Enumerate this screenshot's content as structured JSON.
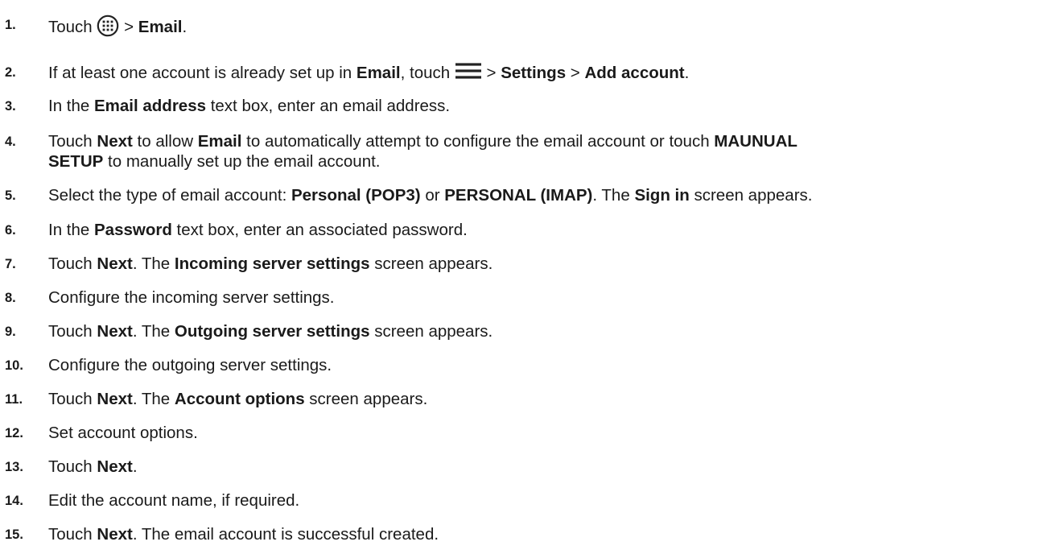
{
  "icons": {
    "apps": "apps-grid-icon",
    "menu": "hamburger-menu-icon"
  },
  "steps": [
    {
      "num": "1.",
      "parts": [
        {
          "t": "Touch "
        },
        {
          "icon": "apps"
        },
        {
          "t": " > "
        },
        {
          "t": "Email",
          "b": 1
        },
        {
          "t": "."
        }
      ]
    },
    {
      "num": "2.",
      "parts": [
        {
          "t": "If at least one account is already set up in "
        },
        {
          "t": "Email",
          "b": 1
        },
        {
          "t": ", touch "
        },
        {
          "icon": "menu"
        },
        {
          "t": " > "
        },
        {
          "t": "Settings",
          "b": 1
        },
        {
          "t": " > "
        },
        {
          "t": "Add account",
          "b": 1
        },
        {
          "t": "."
        }
      ]
    },
    {
      "num": "3.",
      "parts": [
        {
          "t": "In the "
        },
        {
          "t": "Email address",
          "b": 1
        },
        {
          "t": " text box, enter an email address."
        }
      ]
    },
    {
      "num": "4.",
      "parts": [
        {
          "t": "Touch "
        },
        {
          "t": "Next",
          "b": 1
        },
        {
          "t": " to allow "
        },
        {
          "t": "Email",
          "b": 1
        },
        {
          "t": " to automatically attempt to configure the email account or touch "
        },
        {
          "t": "MAUNUAL",
          "b": 1
        },
        {
          "br": 1
        },
        {
          "t": "SETUP",
          "b": 1
        },
        {
          "t": " to manually set up the email account."
        }
      ]
    },
    {
      "num": "5.",
      "parts": [
        {
          "t": "Select the type of email account: "
        },
        {
          "t": "Personal (POP3)",
          "b": 1
        },
        {
          "t": " or "
        },
        {
          "t": "PERSONAL (IMAP)",
          "b": 1
        },
        {
          "t": ". The "
        },
        {
          "t": "Sign in",
          "b": 1
        },
        {
          "t": " screen appears."
        }
      ]
    },
    {
      "num": "6.",
      "parts": [
        {
          "t": "In the "
        },
        {
          "t": "Password",
          "b": 1
        },
        {
          "t": " text box, enter an associated password."
        }
      ]
    },
    {
      "num": "7.",
      "parts": [
        {
          "t": "Touch "
        },
        {
          "t": "Next",
          "b": 1
        },
        {
          "t": ". The "
        },
        {
          "t": "Incoming server settings",
          "b": 1
        },
        {
          "t": " screen appears."
        }
      ]
    },
    {
      "num": "8.",
      "parts": [
        {
          "t": "Configure the incoming server settings."
        }
      ]
    },
    {
      "num": "9.",
      "parts": [
        {
          "t": "Touch "
        },
        {
          "t": "Next",
          "b": 1
        },
        {
          "t": ". The "
        },
        {
          "t": "Outgoing server settings",
          "b": 1
        },
        {
          "t": " screen appears."
        }
      ]
    },
    {
      "num": "10.",
      "parts": [
        {
          "t": "Configure the outgoing server settings."
        }
      ]
    },
    {
      "num": "11.",
      "parts": [
        {
          "t": "Touch "
        },
        {
          "t": "Next",
          "b": 1
        },
        {
          "t": ". The "
        },
        {
          "t": "Account options",
          "b": 1
        },
        {
          "t": " screen appears."
        }
      ]
    },
    {
      "num": "12.",
      "parts": [
        {
          "t": "Set account options."
        }
      ]
    },
    {
      "num": "13.",
      "parts": [
        {
          "t": "Touch "
        },
        {
          "t": "Next",
          "b": 1
        },
        {
          "t": "."
        }
      ]
    },
    {
      "num": "14.",
      "parts": [
        {
          "t": "Edit the account name, if required."
        }
      ]
    },
    {
      "num": "15.",
      "parts": [
        {
          "t": "Touch "
        },
        {
          "t": "Next",
          "b": 1
        },
        {
          "t": ". The email account is successful created."
        }
      ]
    }
  ]
}
